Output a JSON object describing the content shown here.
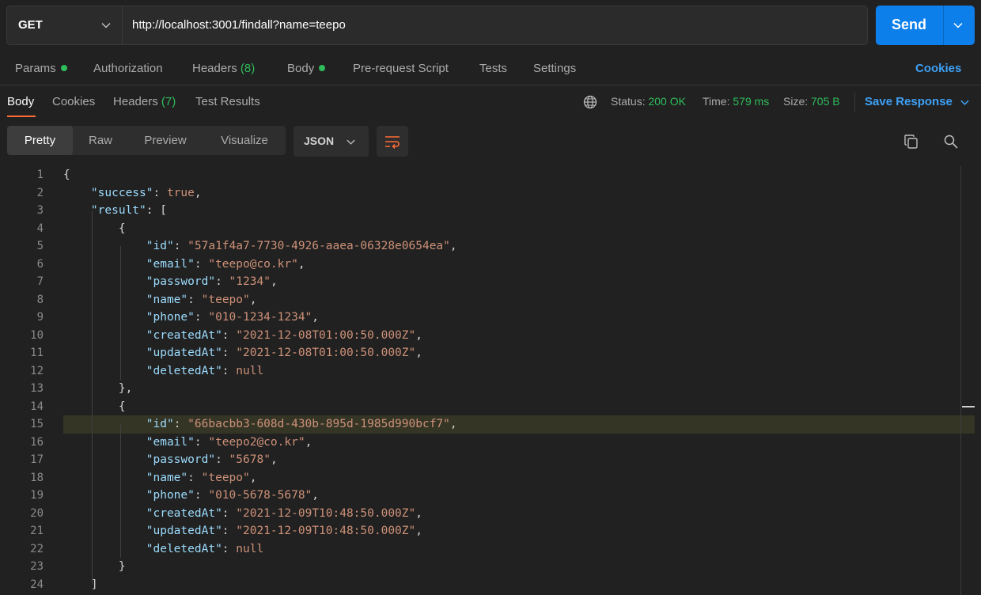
{
  "request": {
    "method": "GET",
    "url": "http://localhost:3001/findall?name=teepo",
    "send_label": "Send"
  },
  "request_tabs": {
    "params": "Params",
    "authorization": "Authorization",
    "headers": "Headers",
    "headers_count": "(8)",
    "body": "Body",
    "prerequest": "Pre-request Script",
    "tests": "Tests",
    "settings": "Settings",
    "cookies": "Cookies"
  },
  "response_tabs": {
    "body": "Body",
    "cookies": "Cookies",
    "headers": "Headers",
    "headers_count": "(7)",
    "test_results": "Test Results"
  },
  "response_meta": {
    "status_label": "Status:",
    "status_value": "200 OK",
    "time_label": "Time:",
    "time_value": "579 ms",
    "size_label": "Size:",
    "size_value": "705 B",
    "save_response": "Save Response"
  },
  "view_modes": {
    "pretty": "Pretty",
    "raw": "Raw",
    "preview": "Preview",
    "visualize": "Visualize",
    "format": "JSON"
  },
  "colors": {
    "accent_blue": "#0c7fea",
    "status_green": "#2fbd5b",
    "tab_orange": "#ff6c37",
    "json_key": "#9cdcfe",
    "json_string": "#ce9178"
  },
  "code_lines": [
    [
      {
        "t": "p",
        "v": "{"
      }
    ],
    [
      {
        "t": "i",
        "v": "    "
      },
      {
        "t": "k",
        "v": "\"success\""
      },
      {
        "t": "p",
        "v": ": "
      },
      {
        "t": "b",
        "v": "true"
      },
      {
        "t": "p",
        "v": ","
      }
    ],
    [
      {
        "t": "i",
        "v": "    "
      },
      {
        "t": "k",
        "v": "\"result\""
      },
      {
        "t": "p",
        "v": ": ["
      }
    ],
    [
      {
        "t": "i",
        "v": "        "
      },
      {
        "t": "p",
        "v": "{"
      }
    ],
    [
      {
        "t": "i",
        "v": "            "
      },
      {
        "t": "k",
        "v": "\"id\""
      },
      {
        "t": "p",
        "v": ": "
      },
      {
        "t": "s",
        "v": "\"57a1f4a7-7730-4926-aaea-06328e0654ea\""
      },
      {
        "t": "p",
        "v": ","
      }
    ],
    [
      {
        "t": "i",
        "v": "            "
      },
      {
        "t": "k",
        "v": "\"email\""
      },
      {
        "t": "p",
        "v": ": "
      },
      {
        "t": "s",
        "v": "\"teepo@co.kr\""
      },
      {
        "t": "p",
        "v": ","
      }
    ],
    [
      {
        "t": "i",
        "v": "            "
      },
      {
        "t": "k",
        "v": "\"password\""
      },
      {
        "t": "p",
        "v": ": "
      },
      {
        "t": "s",
        "v": "\"1234\""
      },
      {
        "t": "p",
        "v": ","
      }
    ],
    [
      {
        "t": "i",
        "v": "            "
      },
      {
        "t": "k",
        "v": "\"name\""
      },
      {
        "t": "p",
        "v": ": "
      },
      {
        "t": "s",
        "v": "\"teepo\""
      },
      {
        "t": "p",
        "v": ","
      }
    ],
    [
      {
        "t": "i",
        "v": "            "
      },
      {
        "t": "k",
        "v": "\"phone\""
      },
      {
        "t": "p",
        "v": ": "
      },
      {
        "t": "s",
        "v": "\"010-1234-1234\""
      },
      {
        "t": "p",
        "v": ","
      }
    ],
    [
      {
        "t": "i",
        "v": "            "
      },
      {
        "t": "k",
        "v": "\"createdAt\""
      },
      {
        "t": "p",
        "v": ": "
      },
      {
        "t": "s",
        "v": "\"2021-12-08T01:00:50.000Z\""
      },
      {
        "t": "p",
        "v": ","
      }
    ],
    [
      {
        "t": "i",
        "v": "            "
      },
      {
        "t": "k",
        "v": "\"updatedAt\""
      },
      {
        "t": "p",
        "v": ": "
      },
      {
        "t": "s",
        "v": "\"2021-12-08T01:00:50.000Z\""
      },
      {
        "t": "p",
        "v": ","
      }
    ],
    [
      {
        "t": "i",
        "v": "            "
      },
      {
        "t": "k",
        "v": "\"deletedAt\""
      },
      {
        "t": "p",
        "v": ": "
      },
      {
        "t": "n",
        "v": "null"
      }
    ],
    [
      {
        "t": "i",
        "v": "        "
      },
      {
        "t": "p",
        "v": "},"
      }
    ],
    [
      {
        "t": "i",
        "v": "        "
      },
      {
        "t": "p",
        "v": "{"
      }
    ],
    [
      {
        "t": "i",
        "v": "            "
      },
      {
        "t": "k",
        "v": "\"id\""
      },
      {
        "t": "p",
        "v": ": "
      },
      {
        "t": "s",
        "v": "\"66bacbb3-608d-430b-895d-1985d990bcf7\""
      },
      {
        "t": "p",
        "v": ","
      }
    ],
    [
      {
        "t": "i",
        "v": "            "
      },
      {
        "t": "k",
        "v": "\"email\""
      },
      {
        "t": "p",
        "v": ": "
      },
      {
        "t": "s",
        "v": "\"teepo2@co.kr\""
      },
      {
        "t": "p",
        "v": ","
      }
    ],
    [
      {
        "t": "i",
        "v": "            "
      },
      {
        "t": "k",
        "v": "\"password\""
      },
      {
        "t": "p",
        "v": ": "
      },
      {
        "t": "s",
        "v": "\"5678\""
      },
      {
        "t": "p",
        "v": ","
      }
    ],
    [
      {
        "t": "i",
        "v": "            "
      },
      {
        "t": "k",
        "v": "\"name\""
      },
      {
        "t": "p",
        "v": ": "
      },
      {
        "t": "s",
        "v": "\"teepo\""
      },
      {
        "t": "p",
        "v": ","
      }
    ],
    [
      {
        "t": "i",
        "v": "            "
      },
      {
        "t": "k",
        "v": "\"phone\""
      },
      {
        "t": "p",
        "v": ": "
      },
      {
        "t": "s",
        "v": "\"010-5678-5678\""
      },
      {
        "t": "p",
        "v": ","
      }
    ],
    [
      {
        "t": "i",
        "v": "            "
      },
      {
        "t": "k",
        "v": "\"createdAt\""
      },
      {
        "t": "p",
        "v": ": "
      },
      {
        "t": "s",
        "v": "\"2021-12-09T10:48:50.000Z\""
      },
      {
        "t": "p",
        "v": ","
      }
    ],
    [
      {
        "t": "i",
        "v": "            "
      },
      {
        "t": "k",
        "v": "\"updatedAt\""
      },
      {
        "t": "p",
        "v": ": "
      },
      {
        "t": "s",
        "v": "\"2021-12-09T10:48:50.000Z\""
      },
      {
        "t": "p",
        "v": ","
      }
    ],
    [
      {
        "t": "i",
        "v": "            "
      },
      {
        "t": "k",
        "v": "\"deletedAt\""
      },
      {
        "t": "p",
        "v": ": "
      },
      {
        "t": "n",
        "v": "null"
      }
    ],
    [
      {
        "t": "i",
        "v": "        "
      },
      {
        "t": "p",
        "v": "}"
      }
    ],
    [
      {
        "t": "i",
        "v": "    "
      },
      {
        "t": "p",
        "v": "]"
      }
    ]
  ],
  "highlighted_line": 15
}
